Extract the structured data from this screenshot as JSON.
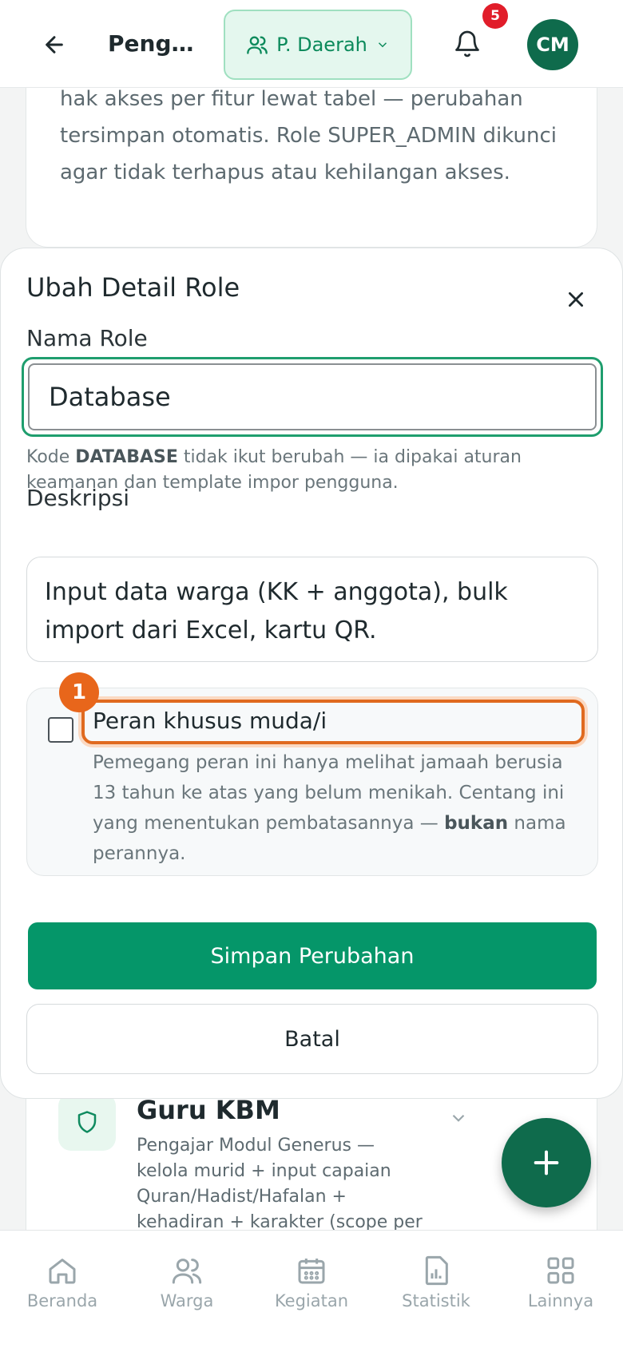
{
  "header": {
    "title": "Pengat...",
    "scope_label": "P. Daerah",
    "notification_count": "5",
    "avatar_initials": "CM"
  },
  "background_card": {
    "text": "hak akses per fitur lewat tabel — perubahan tersimpan otomatis. Role SUPER_ADMIN dikunci agar tidak terhapus atau kehilangan akses."
  },
  "role_item": {
    "name": "Guru KBM",
    "description": "Pengajar Modul Generus — kelola murid + input capaian Quran/Hadist/Hafalan + kehadiran + karakter (scope per"
  },
  "modal": {
    "title": "Ubah Detail Role",
    "name_label": "Nama Role",
    "name_value": "Database",
    "hint_prefix": "Kode ",
    "hint_code": "DATABASE",
    "hint_suffix": " tidak ikut berubah — ia dipakai aturan keamanan dan template impor pengguna.",
    "desc_label": "Deskripsi",
    "desc_value": "Input data warga (KK + anggota), bulk import dari Excel, kartu QR.",
    "checkbox_label": "Peran khusus muda/i",
    "checkbox_desc_prefix": "Pemegang peran ini hanya melihat jamaah berusia 13 tahun ke atas yang belum menikah. Centang ini yang menentukan pembatasannya — ",
    "checkbox_desc_bold": "bukan",
    "checkbox_desc_suffix": " nama perannya.",
    "step_badge": "1",
    "save_label": "Simpan Perubahan",
    "cancel_label": "Batal"
  },
  "bottom_nav": [
    {
      "label": "Beranda",
      "icon": "home-icon"
    },
    {
      "label": "Warga",
      "icon": "users-icon"
    },
    {
      "label": "Kegiatan",
      "icon": "calendar-icon"
    },
    {
      "label": "Statistik",
      "icon": "chart-icon"
    },
    {
      "label": "Lainnya",
      "icon": "grid-icon"
    }
  ],
  "colors": {
    "primary": "#059669",
    "primary_dark": "#0f6b4c",
    "highlight": "#e06a1f",
    "badge": "#e11d2a"
  }
}
